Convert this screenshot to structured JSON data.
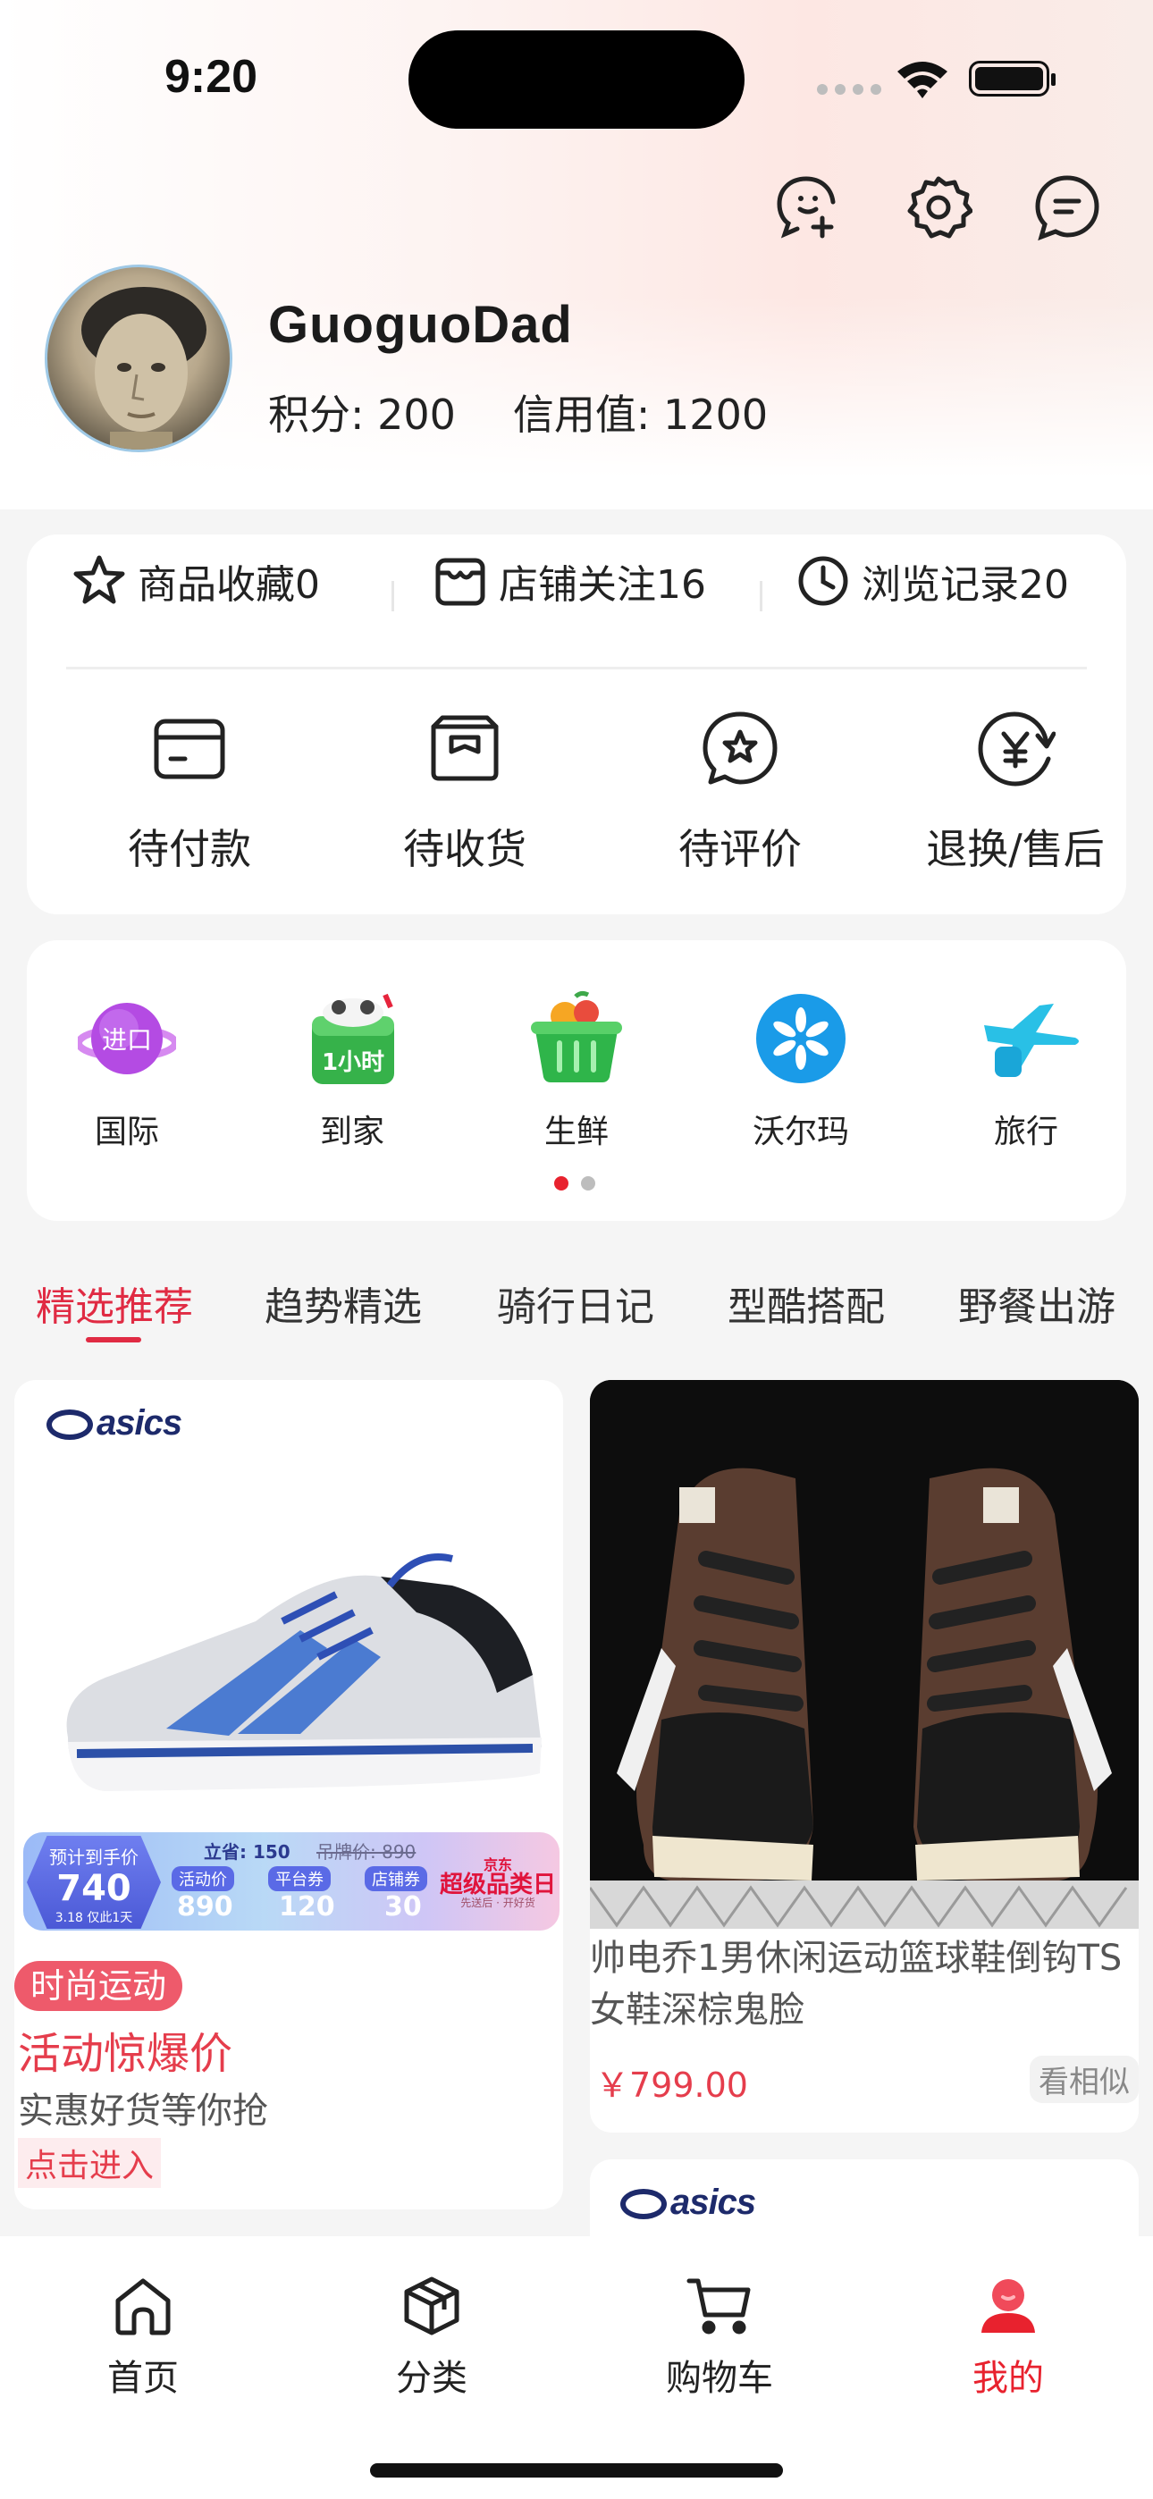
{
  "status_bar": {
    "time": "9:20"
  },
  "profile": {
    "username": "GuoguoDad",
    "points_label": "积分: 200",
    "credit_label": "信用值: 1200"
  },
  "top_icons": [
    "add-friend-icon",
    "gear-icon",
    "message-icon"
  ],
  "quick_links": [
    {
      "icon": "star-icon",
      "label": "商品收藏0"
    },
    {
      "icon": "store-icon",
      "label": "店铺关注16"
    },
    {
      "icon": "clock-icon",
      "label": "浏览记录20"
    }
  ],
  "orders": [
    {
      "icon": "card-icon",
      "label": "待付款"
    },
    {
      "icon": "package-icon",
      "label": "待收货"
    },
    {
      "icon": "review-icon",
      "label": "待评价"
    },
    {
      "icon": "refund-icon",
      "label": "退换/售后"
    }
  ],
  "services": [
    {
      "label": "国际",
      "badge": "进口",
      "icon": "global-planet-icon"
    },
    {
      "label": "到家",
      "badge": "1小时",
      "icon": "delivery-box-icon"
    },
    {
      "label": "生鲜",
      "icon": "basket-icon"
    },
    {
      "label": "沃尔玛",
      "icon": "walmart-spark-icon"
    },
    {
      "label": "旅行",
      "icon": "airplane-icon"
    }
  ],
  "carousel_pages": 2,
  "feed_tabs": [
    {
      "label": "精选推荐",
      "active": true
    },
    {
      "label": "趋势精选"
    },
    {
      "label": "骑行日记"
    },
    {
      "label": "型酷搭配"
    },
    {
      "label": "野餐出游"
    }
  ],
  "products": {
    "left": {
      "brand": "asics",
      "promo": {
        "est_label": "预计到手价",
        "est_price": "740",
        "est_note": "3.18 仅此1天",
        "save": "立省: 150",
        "tag_price": "吊牌价: 890",
        "chips": [
          {
            "label": "活动价",
            "value": "890"
          },
          {
            "label": "平台券",
            "value": "120"
          },
          {
            "label": "店铺券",
            "value": "30"
          }
        ],
        "jd_top": "京东",
        "jd_main": "超级品类日",
        "jd_sub": "先送后 · 开好货"
      },
      "tag": "时尚运动",
      "title": "活动惊爆价",
      "subtitle": "实惠好货等你抢",
      "link": "点击进入"
    },
    "right": {
      "title": "帅电乔1男休闲运动篮球鞋倒钩TS 女鞋深棕鬼脸",
      "price": "￥799.00",
      "similar": "看相似"
    },
    "right2": {
      "brand": "asics"
    }
  },
  "tab_bar": [
    {
      "label": "首页",
      "icon": "home-icon"
    },
    {
      "label": "分类",
      "icon": "cube-icon"
    },
    {
      "label": "购物车",
      "icon": "cart-icon"
    },
    {
      "label": "我的",
      "icon": "user-icon",
      "active": true
    }
  ],
  "colors": {
    "accent": "#e02b43",
    "price": "#e53d4c",
    "active_tab": "#e8222e"
  }
}
